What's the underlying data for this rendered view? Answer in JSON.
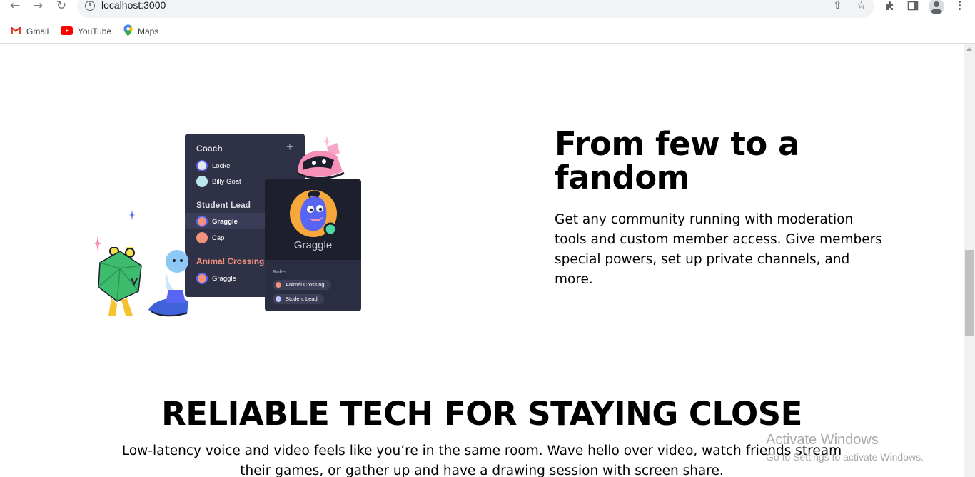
{
  "browser": {
    "url": "localhost:3000",
    "bookmarks": [
      {
        "label": "Gmail",
        "icon": "gmail-icon"
      },
      {
        "label": "YouTube",
        "icon": "youtube-icon"
      },
      {
        "label": "Maps",
        "icon": "maps-icon"
      }
    ]
  },
  "illustration": {
    "groups": [
      {
        "heading": "Coach",
        "members": [
          "Locke",
          "Billy Goat"
        ]
      },
      {
        "heading": "Student Lead",
        "members": [
          "Graggle",
          "Cap"
        ]
      },
      {
        "heading": "Animal Crossing",
        "members": [
          "Graggle"
        ]
      }
    ],
    "profile": {
      "name": "Graggle",
      "roles_label": "Roles",
      "roles": [
        "Animal Crossing",
        "Student Lead"
      ]
    }
  },
  "feature": {
    "title": "From few to a fandom",
    "description": "Get any community running with moderation tools and custom member access. Give members special powers, set up private channels, and more."
  },
  "reliable": {
    "title": "RELIABLE TECH FOR STAYING CLOSE",
    "description": "Low-latency voice and video feels like you’re in the same room. Wave hello over video, watch friends stream their games, or gather up and have a drawing session with screen share."
  },
  "watermark": {
    "title": "Activate Windows",
    "subtitle": "Go to Settings to activate Windows."
  },
  "colors": {
    "panel_dark": "#2f3147",
    "accent_salmon": "#f2917c",
    "accent_green": "#4fd8a6",
    "accent_blue": "#5865f2"
  }
}
